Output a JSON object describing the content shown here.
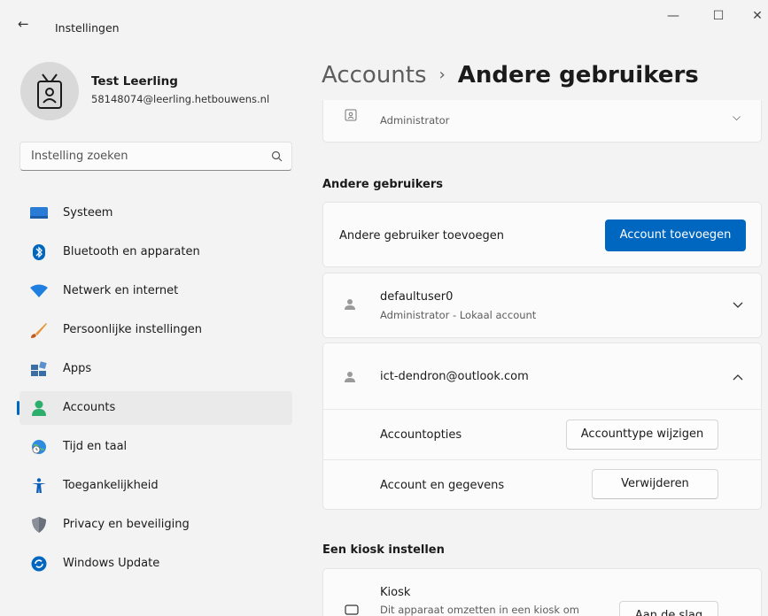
{
  "window": {
    "title": "Instellingen",
    "back_glyph": "←",
    "min_glyph": "—",
    "max_glyph": "☐",
    "close_glyph": "✕"
  },
  "profile": {
    "name": "Test Leerling",
    "email": "58148074@leerling.hetbouwens.nl"
  },
  "search": {
    "placeholder": "Instelling zoeken"
  },
  "nav": {
    "items": [
      {
        "label": "Systeem",
        "icon": "monitor-icon"
      },
      {
        "label": "Bluetooth en apparaten",
        "icon": "bluetooth-icon"
      },
      {
        "label": "Netwerk en internet",
        "icon": "wifi-icon"
      },
      {
        "label": "Persoonlijke instellingen",
        "icon": "brush-icon"
      },
      {
        "label": "Apps",
        "icon": "apps-icon"
      },
      {
        "label": "Accounts",
        "icon": "accounts-icon"
      },
      {
        "label": "Tijd en taal",
        "icon": "clock-globe-icon"
      },
      {
        "label": "Toegankelijkheid",
        "icon": "accessibility-icon"
      },
      {
        "label": "Privacy en beveiliging",
        "icon": "shield-icon"
      },
      {
        "label": "Windows Update",
        "icon": "update-icon"
      }
    ],
    "active_index": 5
  },
  "header": {
    "parent": "Accounts",
    "separator": "›",
    "current": "Andere gebruikers"
  },
  "top_account": {
    "sub": "Administrator"
  },
  "other_users": {
    "title": "Andere gebruikers",
    "add_label": "Andere gebruiker toevoegen",
    "add_button": "Account toevoegen",
    "users": [
      {
        "name": "defaultuser0",
        "sub": "Administrator - Lokaal account",
        "expanded": false
      },
      {
        "name": "ict-dendron@outlook.com",
        "sub": "",
        "expanded": true
      }
    ],
    "options_label": "Accountopties",
    "options_button": "Accounttype wijzigen",
    "data_label": "Account en gegevens",
    "data_button": "Verwijderen"
  },
  "kiosk": {
    "title": "Een kiosk instellen",
    "label": "Kiosk",
    "sub": "Dit apparaat omzetten in een kiosk om",
    "button": "Aan de slag"
  },
  "colors": {
    "accent": "#0067c0",
    "background": "#f3f3f3",
    "card": "#fbfbfb"
  }
}
